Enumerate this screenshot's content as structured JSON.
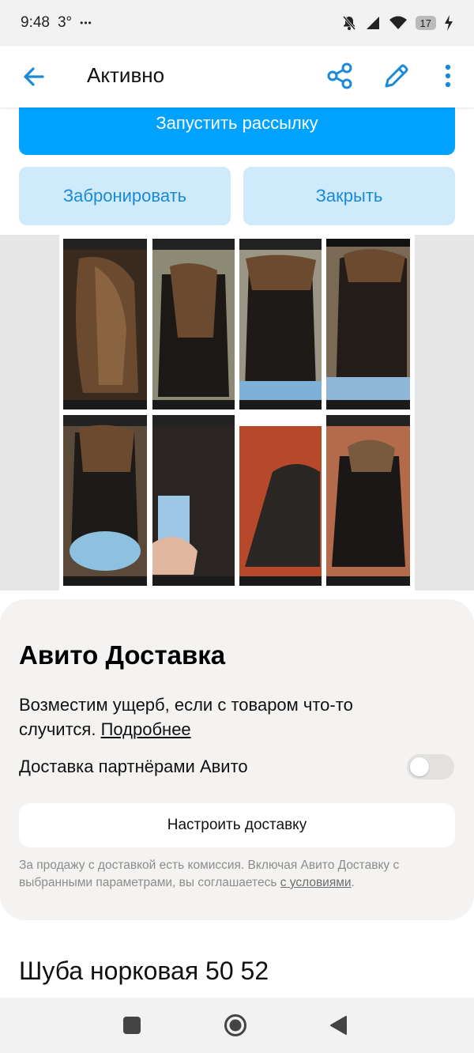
{
  "status_bar": {
    "time": "9:48",
    "temperature": "3°",
    "more_dots": "•••",
    "battery": "17",
    "icons": [
      "bell-off-icon",
      "signal-icon",
      "wifi-icon",
      "battery-icon",
      "charging-icon"
    ]
  },
  "app_bar": {
    "title": "Активно",
    "icons": [
      "arrow-left-icon",
      "share-icon",
      "pencil-icon",
      "more-vert-icon"
    ],
    "accent": "#1a8ad8"
  },
  "actions": {
    "primary": "Запустить рассылку",
    "book": "Забронировать",
    "close": "Закрыть",
    "primary_color": "#00a2ff",
    "secondary_color": "#cfeafb"
  },
  "photo": {
    "description_icon": "photo-collage"
  },
  "delivery": {
    "title": "Авито Доставка",
    "desc_text": "Возместим ущерб, если с товаром что-то случится.",
    "desc_link": "Подробнее",
    "toggle_label": "Доставка партнёрами Авито",
    "toggle_on": false,
    "setup_button": "Настроить доставку",
    "fineprint_text": "За продажу с доставкой есть комиссия. Включая Авито Доставку с выбранными параметрами, вы соглашаетесь",
    "fineprint_link": "с условиями",
    "fineprint_end": "."
  },
  "listing": {
    "title": "Шуба норковая 50 52"
  },
  "nav_bar": {
    "icons": [
      "recents-square-icon",
      "home-circle-icon",
      "back-triangle-icon"
    ]
  }
}
